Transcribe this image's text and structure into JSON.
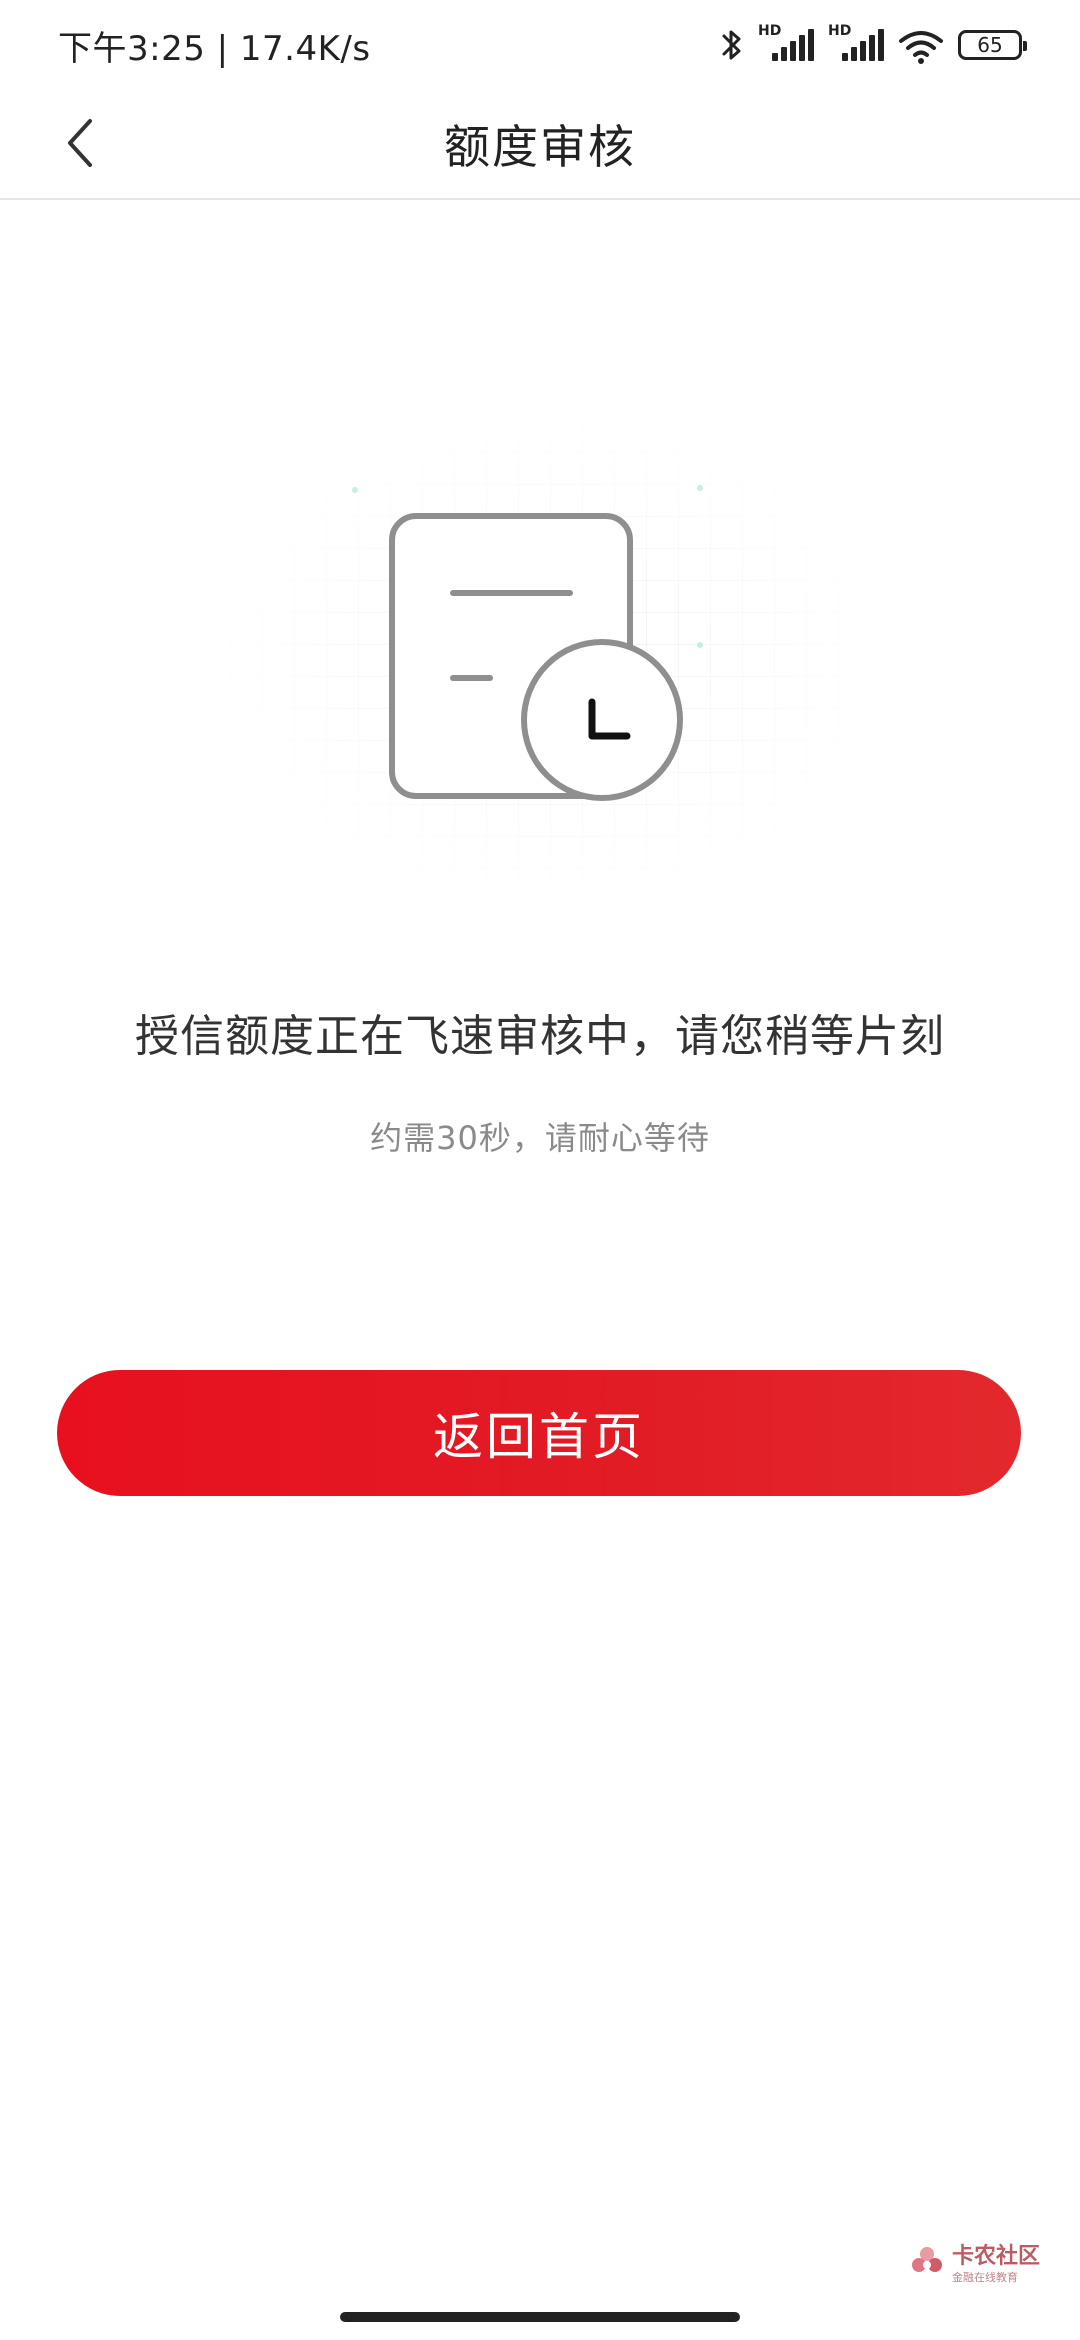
{
  "status_bar": {
    "time_speed": "下午3:25 | 17.4K/s",
    "signal1_label": "HD",
    "signal2_label": "HD",
    "battery": "65",
    "icons": [
      "bluetooth-icon",
      "signal-icon",
      "signal-icon",
      "wifi-icon",
      "battery-icon"
    ]
  },
  "nav": {
    "back_icon": "chevron-left-icon",
    "title": "额度审核"
  },
  "illustration": {
    "icon": "document-clock-icon"
  },
  "content": {
    "main_message": "授信额度正在飞速审核中，请您稍等片刻",
    "sub_message": "约需30秒，请耐心等待"
  },
  "actions": {
    "return_home_label": "返回首页"
  },
  "watermark": {
    "main": "卡农社区",
    "sub": "金融在线教育"
  },
  "colors": {
    "accent": "#e8101e",
    "text_primary": "#333333",
    "text_secondary": "#8a8a8a"
  }
}
